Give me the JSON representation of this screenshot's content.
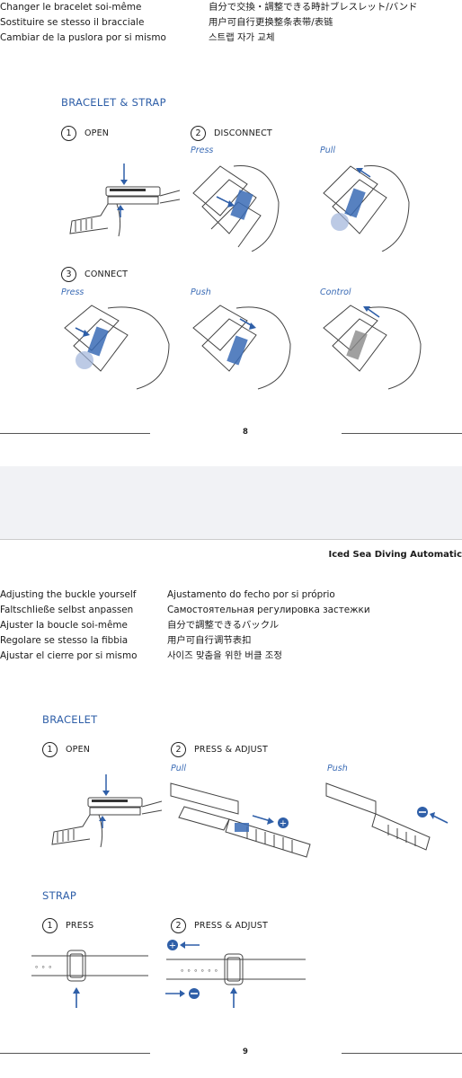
{
  "page1": {
    "left_lines": [
      "Changer le bracelet soi-même",
      "Sostituire se stesso il bracciale",
      "Cambiar de la puslora por si mismo"
    ],
    "right_lines": [
      "自分で交換・調整できる時計ブレスレット/バンド",
      "用户可自行更换整条表带/表链",
      "스트랩 자가 교체"
    ],
    "section_title": "BRACELET & STRAP",
    "step1": {
      "num": "1",
      "label": "OPEN"
    },
    "step2": {
      "num": "2",
      "label": "DISCONNECT",
      "actions": [
        "Press",
        "Pull"
      ]
    },
    "step3": {
      "num": "3",
      "label": "CONNECT",
      "actions": [
        "Press",
        "Push",
        "Control"
      ]
    },
    "page_number": "8"
  },
  "page2": {
    "header_title": "Iced Sea Diving Automatic",
    "left_lines": [
      "Adjusting the buckle yourself",
      "Faltschließe selbst anpassen",
      "Ajuster la boucle soi-même",
      "Regolare se stesso la fibbia",
      "Ajustar el cierre por si mismo"
    ],
    "right_lines": [
      "Ajustamento do fecho por si próprio",
      "Самостоятельная регулировка застежки",
      "自分で調整できるバックル",
      "用户可自行调节表扣",
      "사이즈 맞춤을 위한 버클 조정"
    ],
    "bracelet": {
      "title": "BRACELET",
      "step1": {
        "num": "1",
        "label": "OPEN"
      },
      "step2": {
        "num": "2",
        "label": "PRESS & ADJUST",
        "actions": [
          "Pull",
          "Push"
        ]
      }
    },
    "strap": {
      "title": "STRAP",
      "step1": {
        "num": "1",
        "label": "PRESS"
      },
      "step2": {
        "num": "2",
        "label": "PRESS & ADJUST"
      }
    },
    "page_number": "9"
  },
  "colors": {
    "accent": "#2f5fa8",
    "highlight": "#3a6bb5",
    "page_gap": "#f1f2f5"
  }
}
